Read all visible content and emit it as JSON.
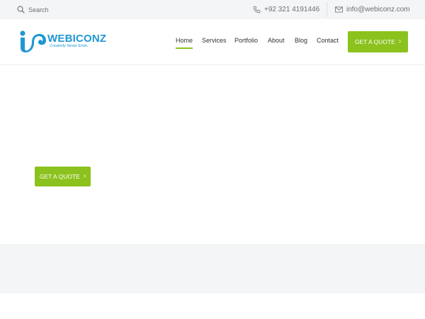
{
  "topbar": {
    "search_label": "Search",
    "phone": "+92 321 4191446",
    "email": "info@webiconz.com"
  },
  "logo": {
    "name": "WEBICONZ",
    "tagline": "Creativity Never Ends.",
    "brand_color": "#1f97d4"
  },
  "nav": {
    "items": [
      {
        "label": "Home",
        "active": true
      },
      {
        "label": "Services",
        "active": false
      },
      {
        "label": "Portfolio",
        "active": false
      },
      {
        "label": "About",
        "active": false
      },
      {
        "label": "Blog",
        "active": false
      },
      {
        "label": "Contact",
        "active": false
      }
    ],
    "quote_label": "GET A QUOTE",
    "accent_color": "#8cc21e"
  },
  "hero": {
    "cta_label": "GET A QUOTE"
  },
  "icons": {
    "search": "search-icon",
    "phone": "phone-icon",
    "email": "envelope-icon",
    "chevron": "chevron-right-icon"
  }
}
